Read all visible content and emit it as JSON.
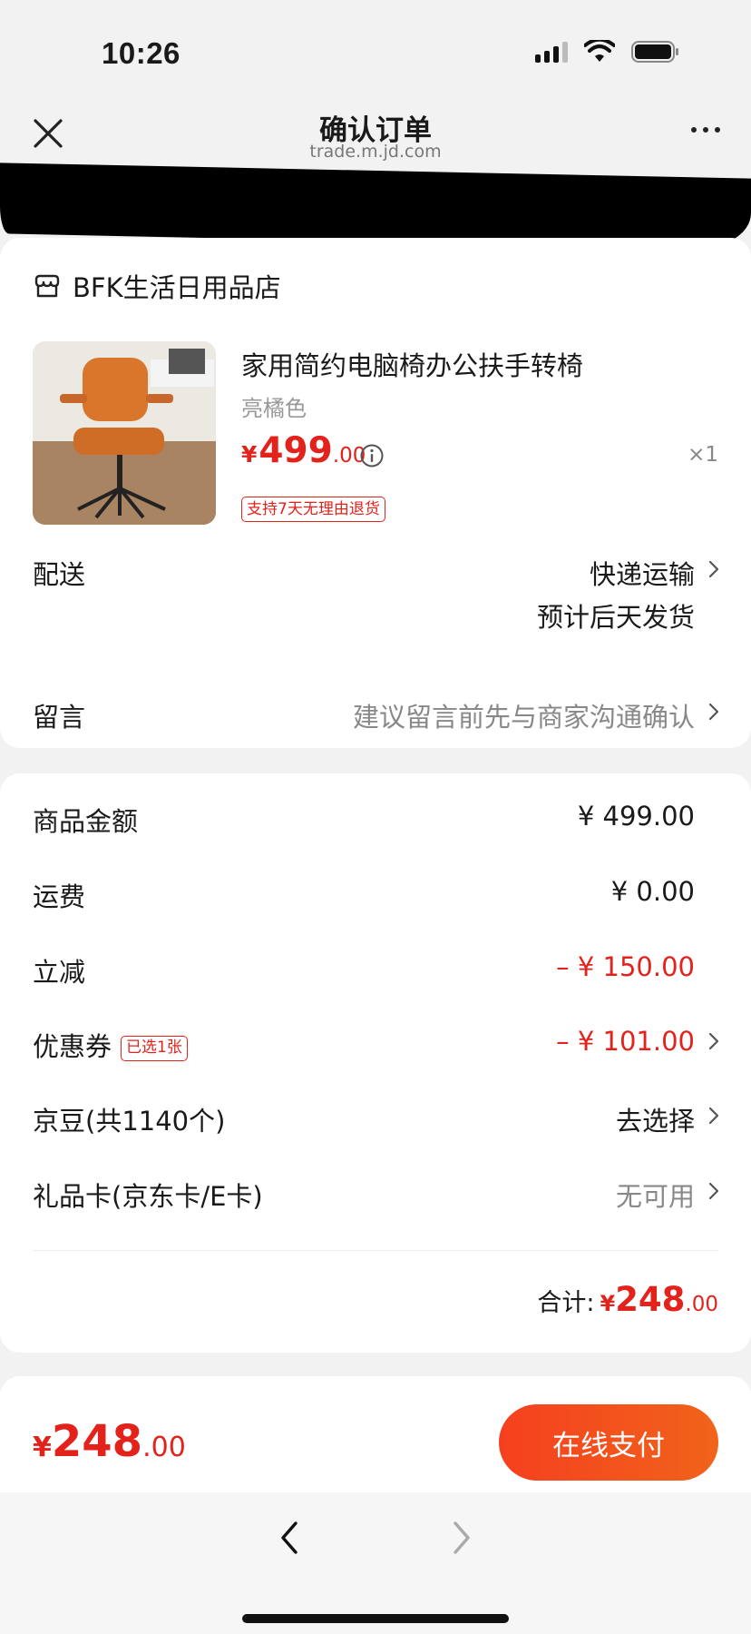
{
  "status_bar": {
    "time": "10:26"
  },
  "nav": {
    "title": "确认订单",
    "subtitle": "trade.m.jd.com"
  },
  "store": {
    "name": "BFK生活日用品店",
    "product": {
      "title": "家用简约电脑椅办公扶手转椅",
      "variant": "亮橘色",
      "price_symbol": "¥",
      "price_int": "499",
      "price_dec": ".00",
      "quantity": "×1",
      "badge": "支持7天无理由退货"
    },
    "shipping": {
      "label": "配送",
      "method": "快递运输",
      "estimate": "预计后天发货"
    },
    "message": {
      "label": "留言",
      "placeholder": "建议留言前先与商家沟通确认"
    }
  },
  "summary": {
    "goods": {
      "label": "商品金额",
      "value": "¥ 499.00"
    },
    "freight": {
      "label": "运费",
      "value": "¥ 0.00"
    },
    "discount": {
      "label": "立减",
      "value": "– ¥ 150.00"
    },
    "coupon": {
      "label": "优惠券",
      "tag": "已选1张",
      "value": "– ¥ 101.00"
    },
    "jingdou": {
      "label": "京豆(共1140个)",
      "value": "去选择"
    },
    "giftcard": {
      "label": "礼品卡(京东卡/E卡)",
      "value": "无可用"
    },
    "total": {
      "label": "合计:",
      "symbol": "¥",
      "int": "248",
      "dec": ".00"
    }
  },
  "bottom": {
    "symbol": "¥",
    "int": "248",
    "dec": ".00",
    "pay_label": "在线支付"
  },
  "colors": {
    "accent": "#e4221c",
    "pay_gradient_start": "#f5401f",
    "pay_gradient_end": "#f1631a"
  },
  "icons": [
    "close-icon",
    "more-icon",
    "store-icon",
    "info-icon",
    "chevron-right-icon",
    "back-arrow-icon",
    "forward-arrow-icon"
  ]
}
